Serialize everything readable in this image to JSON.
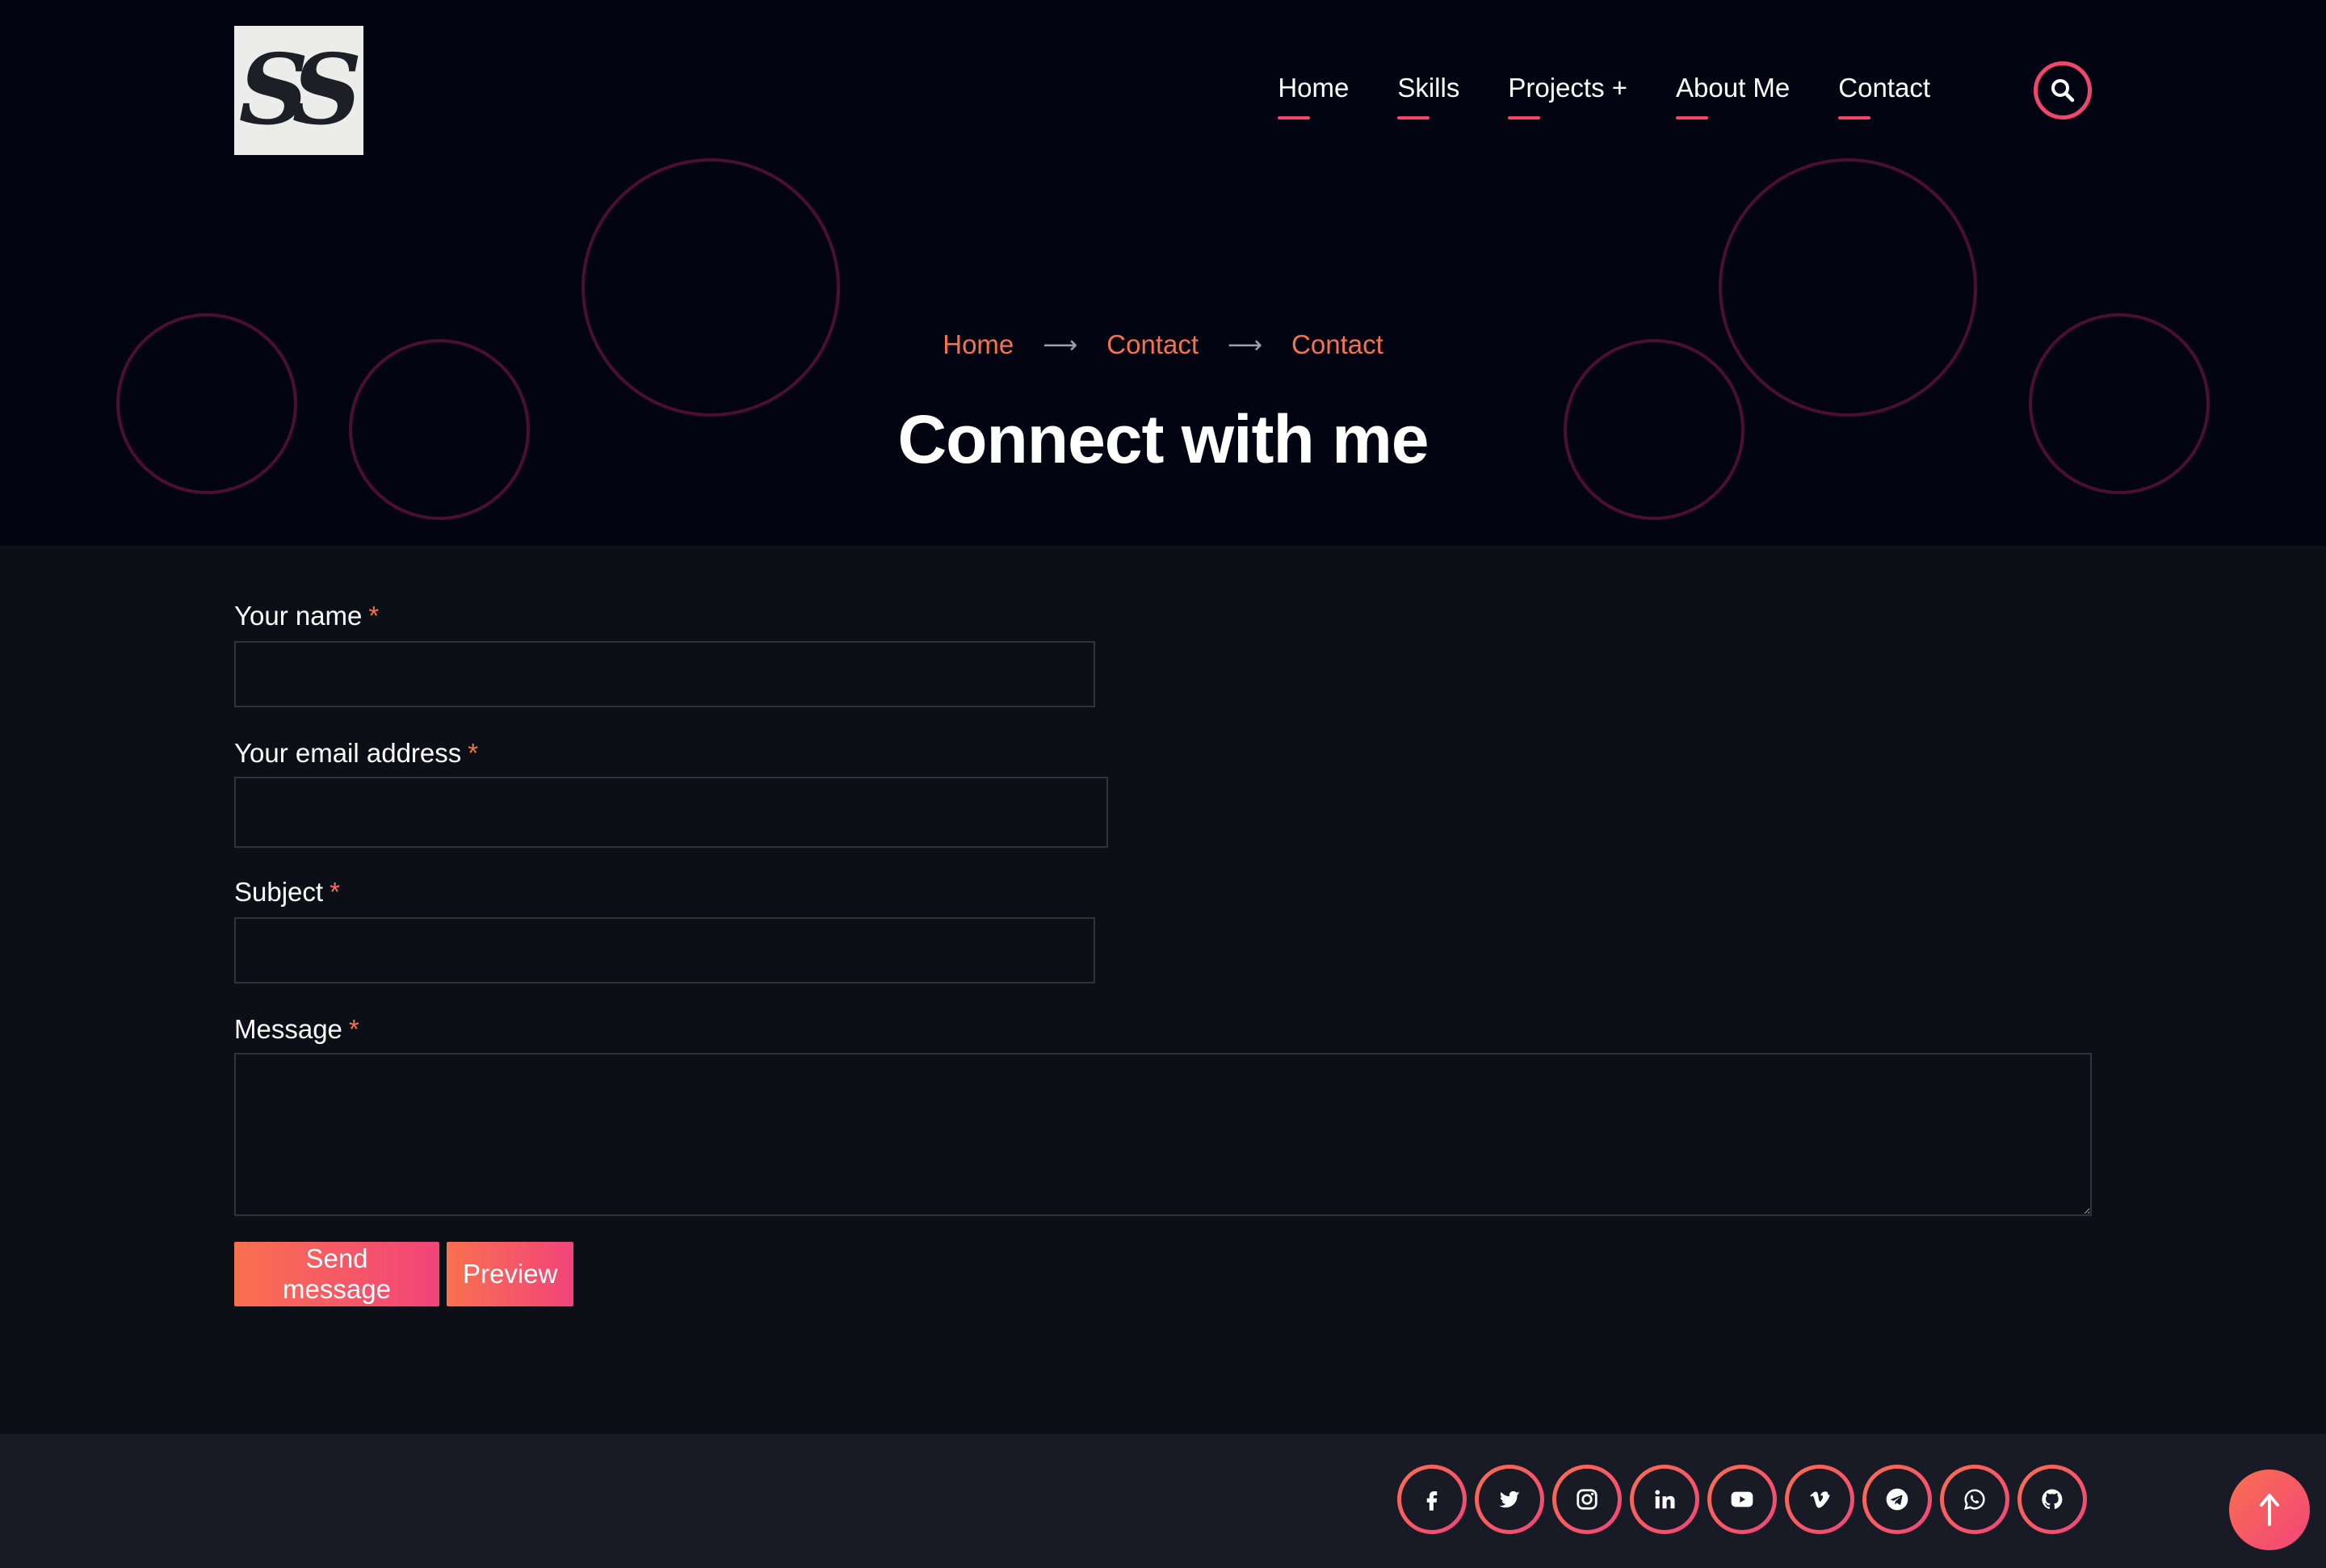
{
  "logo": {
    "alt": "SS",
    "text": "SS"
  },
  "nav": {
    "items": [
      {
        "label": "Home"
      },
      {
        "label": "Skills"
      },
      {
        "label": "Projects +"
      },
      {
        "label": "About Me"
      },
      {
        "label": "Contact"
      }
    ],
    "search_icon": "search-icon"
  },
  "breadcrumb": {
    "items": [
      "Home",
      "Contact",
      "Contact"
    ],
    "separator": "⟶"
  },
  "page_title": "Connect with me",
  "form": {
    "name": {
      "label": "Your name",
      "required_mark": "*",
      "value": ""
    },
    "email": {
      "label": "Your email address",
      "required_mark": "*",
      "value": ""
    },
    "subject": {
      "label": "Subject",
      "required_mark": "*",
      "value": ""
    },
    "message": {
      "label": "Message",
      "required_mark": "*",
      "value": ""
    },
    "send_label": "Send message",
    "preview_label": "Preview"
  },
  "footer": {
    "social": [
      "facebook-icon",
      "twitter-icon",
      "instagram-icon",
      "linkedin-icon",
      "youtube-icon",
      "vimeo-icon",
      "telegram-icon",
      "whatsapp-icon",
      "github-icon"
    ]
  },
  "colors": {
    "accent_orange": "#f9704f",
    "accent_pink": "#f2447a",
    "hero_bg": "#030412",
    "body_bg": "#0d0f17",
    "footer_bg": "#181a26"
  }
}
